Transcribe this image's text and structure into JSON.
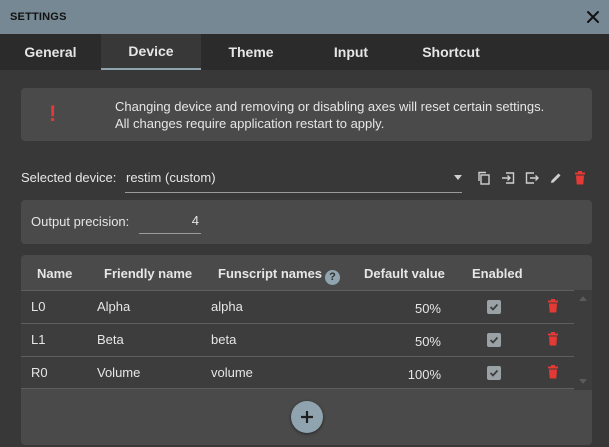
{
  "window": {
    "title": "SETTINGS"
  },
  "tabs": [
    {
      "label": "General",
      "active": false
    },
    {
      "label": "Device",
      "active": true
    },
    {
      "label": "Theme",
      "active": false
    },
    {
      "label": "Input",
      "active": false
    },
    {
      "label": "Shortcut",
      "active": false
    }
  ],
  "warning": {
    "icon": "!",
    "line1": "Changing device and removing or disabling axes will reset certain settings.",
    "line2": "All changes require application restart to apply."
  },
  "device": {
    "label": "Selected device:",
    "selected": "restim (custom)",
    "actions": [
      "copy-icon",
      "import-icon",
      "export-icon",
      "edit-icon",
      "delete-icon"
    ]
  },
  "precision": {
    "label": "Output precision:",
    "value": "4"
  },
  "table": {
    "headers": {
      "name": "Name",
      "friendly": "Friendly name",
      "funscript": "Funscript names",
      "default": "Default value",
      "enabled": "Enabled"
    },
    "rows": [
      {
        "name": "L0",
        "friendly": "Alpha",
        "funscript": "alpha",
        "default": "50%",
        "enabled": true
      },
      {
        "name": "L1",
        "friendly": "Beta",
        "funscript": "beta",
        "default": "50%",
        "enabled": true
      },
      {
        "name": "R0",
        "friendly": "Volume",
        "funscript": "volume",
        "default": "100%",
        "enabled": true
      }
    ]
  },
  "colors": {
    "accent": "#8fa4ae",
    "danger": "#e53935",
    "titlebar": "#768893"
  }
}
